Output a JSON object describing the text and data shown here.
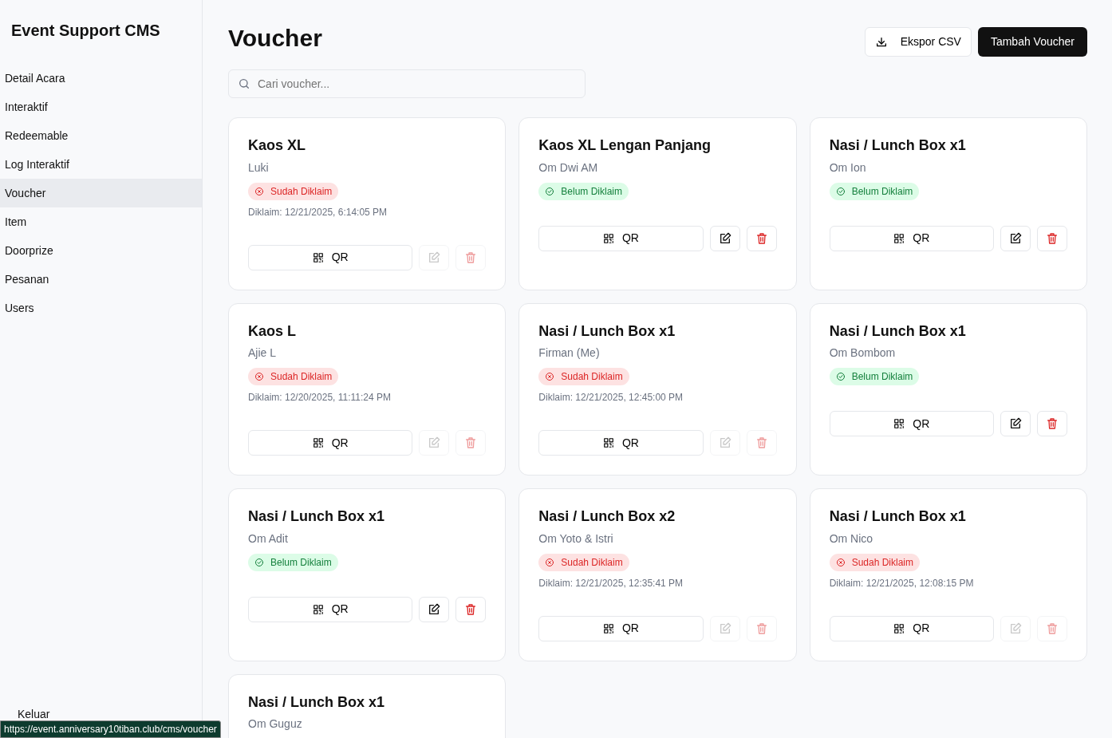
{
  "sidebar": {
    "title": "Event Support CMS",
    "items": [
      {
        "label": "Detail Acara",
        "selected": false
      },
      {
        "label": "Interaktif",
        "selected": false
      },
      {
        "label": "Redeemable",
        "selected": false
      },
      {
        "label": "Log Interaktif",
        "selected": false
      },
      {
        "label": "Voucher",
        "selected": true
      },
      {
        "label": "Item",
        "selected": false
      },
      {
        "label": "Doorprize",
        "selected": false
      },
      {
        "label": "Pesanan",
        "selected": false
      },
      {
        "label": "Users",
        "selected": false
      }
    ],
    "logout": "Keluar"
  },
  "page": {
    "title": "Voucher",
    "export_button": "Ekspor CSV",
    "add_button": "Tambah Voucher"
  },
  "search": {
    "placeholder": "Cari voucher..."
  },
  "vouchers": [
    {
      "title": "Kaos XL",
      "owner": "Luki",
      "claimed": true,
      "status": "Sudah Diklaim",
      "claimed_at": "Diklaim: 12/21/2025, 6:14:05 PM",
      "qr": "QR"
    },
    {
      "title": "Kaos XL Lengan Panjang",
      "owner": "Om Dwi AM",
      "claimed": false,
      "status": "Belum Diklaim",
      "qr": "QR"
    },
    {
      "title": "Nasi / Lunch Box x1",
      "owner": "Om Ion",
      "claimed": false,
      "status": "Belum Diklaim",
      "qr": "QR"
    },
    {
      "title": "Kaos L",
      "owner": "Ajie L",
      "claimed": true,
      "status": "Sudah Diklaim",
      "claimed_at": "Diklaim: 12/20/2025, 11:11:24 PM",
      "qr": "QR"
    },
    {
      "title": "Nasi / Lunch Box x1",
      "owner": "Firman (Me)",
      "claimed": true,
      "status": "Sudah Diklaim",
      "claimed_at": "Diklaim: 12/21/2025, 12:45:00 PM",
      "qr": "QR"
    },
    {
      "title": "Nasi / Lunch Box x1",
      "owner": "Om Bombom",
      "claimed": false,
      "status": "Belum Diklaim",
      "qr": "QR"
    },
    {
      "title": "Nasi / Lunch Box x1",
      "owner": "Om Adit",
      "claimed": false,
      "status": "Belum Diklaim",
      "qr": "QR"
    },
    {
      "title": "Nasi / Lunch Box x2",
      "owner": "Om Yoto & Istri",
      "claimed": true,
      "status": "Sudah Diklaim",
      "claimed_at": "Diklaim: 12/21/2025, 12:35:41 PM",
      "qr": "QR"
    },
    {
      "title": "Nasi / Lunch Box x1",
      "owner": "Om Nico",
      "claimed": true,
      "status": "Sudah Diklaim",
      "claimed_at": "Diklaim: 12/21/2025, 12:08:15 PM",
      "qr": "QR"
    },
    {
      "title": "Nasi / Lunch Box x1",
      "owner": "Om Guguz"
    }
  ],
  "status_url": "https://event.anniversary10tiban.club/cms/voucher"
}
